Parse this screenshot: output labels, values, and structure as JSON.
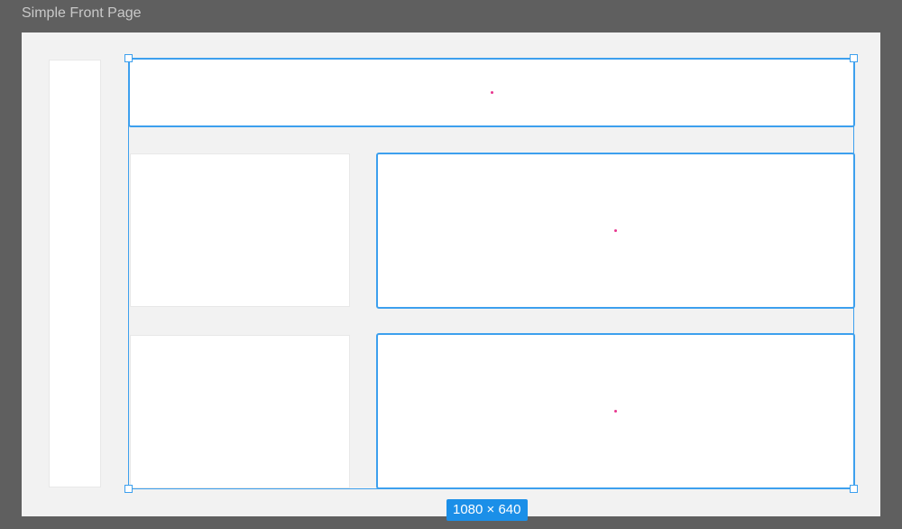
{
  "frame": {
    "title": "Simple Front Page"
  },
  "selection": {
    "size_label": "1080 × 640"
  },
  "colors": {
    "workspace": "#5f5f5f",
    "canvas": "#f2f2f2",
    "card": "#ffffff",
    "selection": "#3da0ee",
    "badge": "#1b8fe8",
    "center_dot": "#e8368f"
  }
}
